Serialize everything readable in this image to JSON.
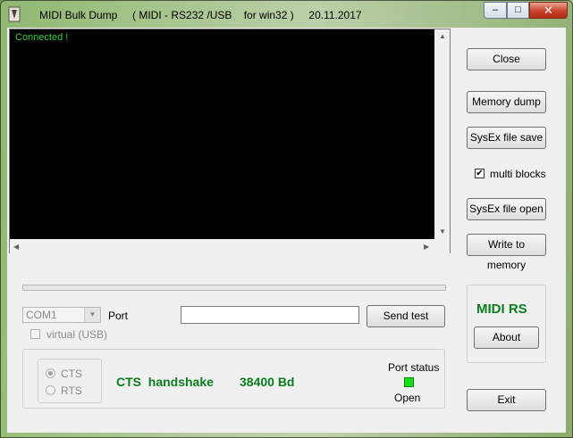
{
  "window": {
    "title": "MIDI Bulk Dump     ( MIDI - RS232 /USB    for win32 )     20.11.2017",
    "min_glyph": "–",
    "max_glyph": "□",
    "close_glyph": "✕"
  },
  "console": {
    "text": "Connected !",
    "left_arrow": "◀",
    "right_arrow": "▶",
    "up_arrow": "▲",
    "down_arrow": "▼"
  },
  "buttons": {
    "close": "Close",
    "memory_dump": "Memory dump",
    "sysex_save": "SysEx file save",
    "sysex_open": "SysEx file open",
    "write_memory": "Write to memory",
    "send_test": "Send test",
    "about": "About",
    "exit": "Exit"
  },
  "multi_blocks": {
    "label": "multi blocks",
    "checked": true,
    "mark": "✔"
  },
  "port": {
    "selected": "COM1",
    "label": "Port",
    "virtual_label": "virtual (USB)",
    "arrow": "▼",
    "test_text": ""
  },
  "handshake": {
    "cts_label": "CTS",
    "rts_label": "RTS",
    "mode_text": "CTS  handshake",
    "baud_text": "38400 Bd"
  },
  "port_status": {
    "label": "Port status",
    "state": "Open",
    "color": "#18e018"
  },
  "brand": {
    "text": "MIDI RS",
    "color": "#0a7d1e"
  }
}
